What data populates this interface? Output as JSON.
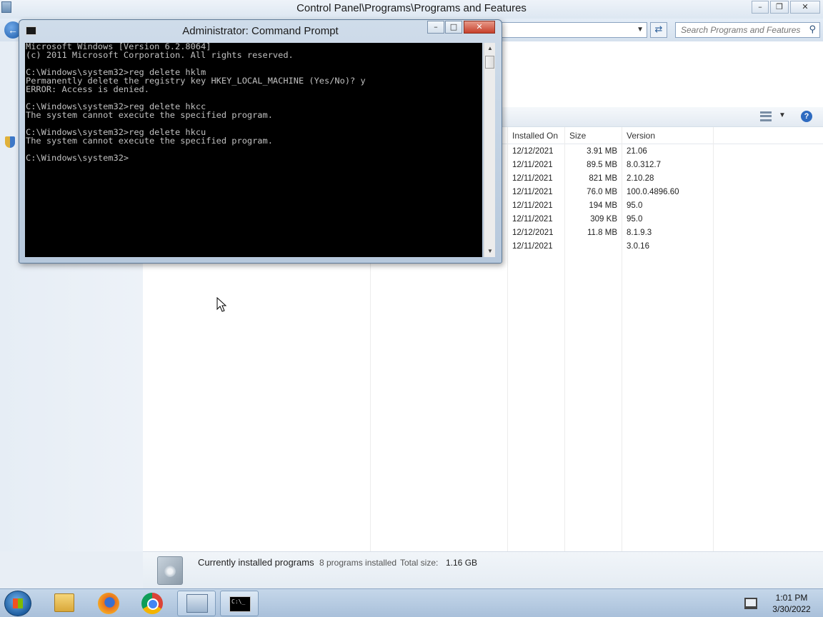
{
  "control_panel": {
    "title": "Control Panel\\Programs\\Programs and Features",
    "search_placeholder": "Search Programs and Features",
    "columns": {
      "installed_on": "Installed On",
      "size": "Size",
      "version": "Version"
    },
    "rows": [
      {
        "installed_on": "12/12/2021",
        "size": "3.91 MB",
        "version": "21.06"
      },
      {
        "installed_on": "12/11/2021",
        "size": "89.5 MB",
        "version": "8.0.312.7"
      },
      {
        "installed_on": "12/11/2021",
        "size": "821 MB",
        "version": "2.10.28"
      },
      {
        "installed_on": "12/11/2021",
        "size": "76.0 MB",
        "version": "100.0.4896.60"
      },
      {
        "installed_on": "12/11/2021",
        "size": "194 MB",
        "version": "95.0"
      },
      {
        "installed_on": "12/11/2021",
        "size": "309 KB",
        "version": "95.0"
      },
      {
        "installed_on": "12/12/2021",
        "size": "11.8 MB",
        "version": "8.1.9.3"
      },
      {
        "installed_on": "12/11/2021",
        "size": "",
        "version": "3.0.16"
      }
    ],
    "status": {
      "main": "Currently installed programs",
      "count": "8 programs installed",
      "total_label": "Total size:",
      "total_value": "1.16 GB"
    }
  },
  "cmd": {
    "title": "Administrator: Command Prompt",
    "output": "Microsoft Windows [Version 6.2.8064]\n(c) 2011 Microsoft Corporation. All rights reserved.\n\nC:\\Windows\\system32>reg delete hklm\nPermanently delete the registry key HKEY_LOCAL_MACHINE (Yes/No)? y\nERROR: Access is denied.\n\nC:\\Windows\\system32>reg delete hkcc\nThe system cannot execute the specified program.\n\nC:\\Windows\\system32>reg delete hkcu\nThe system cannot execute the specified program.\n\nC:\\Windows\\system32>"
  },
  "taskbar": {
    "cmd_icon_text": "C:\\_",
    "clock_time": "1:01 PM",
    "clock_date": "3/30/2022"
  },
  "icons": {
    "back": "back-arrow-icon",
    "refresh": "refresh-icon",
    "search": "search-icon",
    "help": "help-icon",
    "views": "views-icon",
    "start": "windows-logo-icon",
    "explorer": "folder-icon",
    "firefox": "firefox-icon",
    "chrome": "chrome-icon",
    "control_panel": "control-panel-icon",
    "cmd": "command-prompt-icon",
    "network": "network-icon"
  }
}
